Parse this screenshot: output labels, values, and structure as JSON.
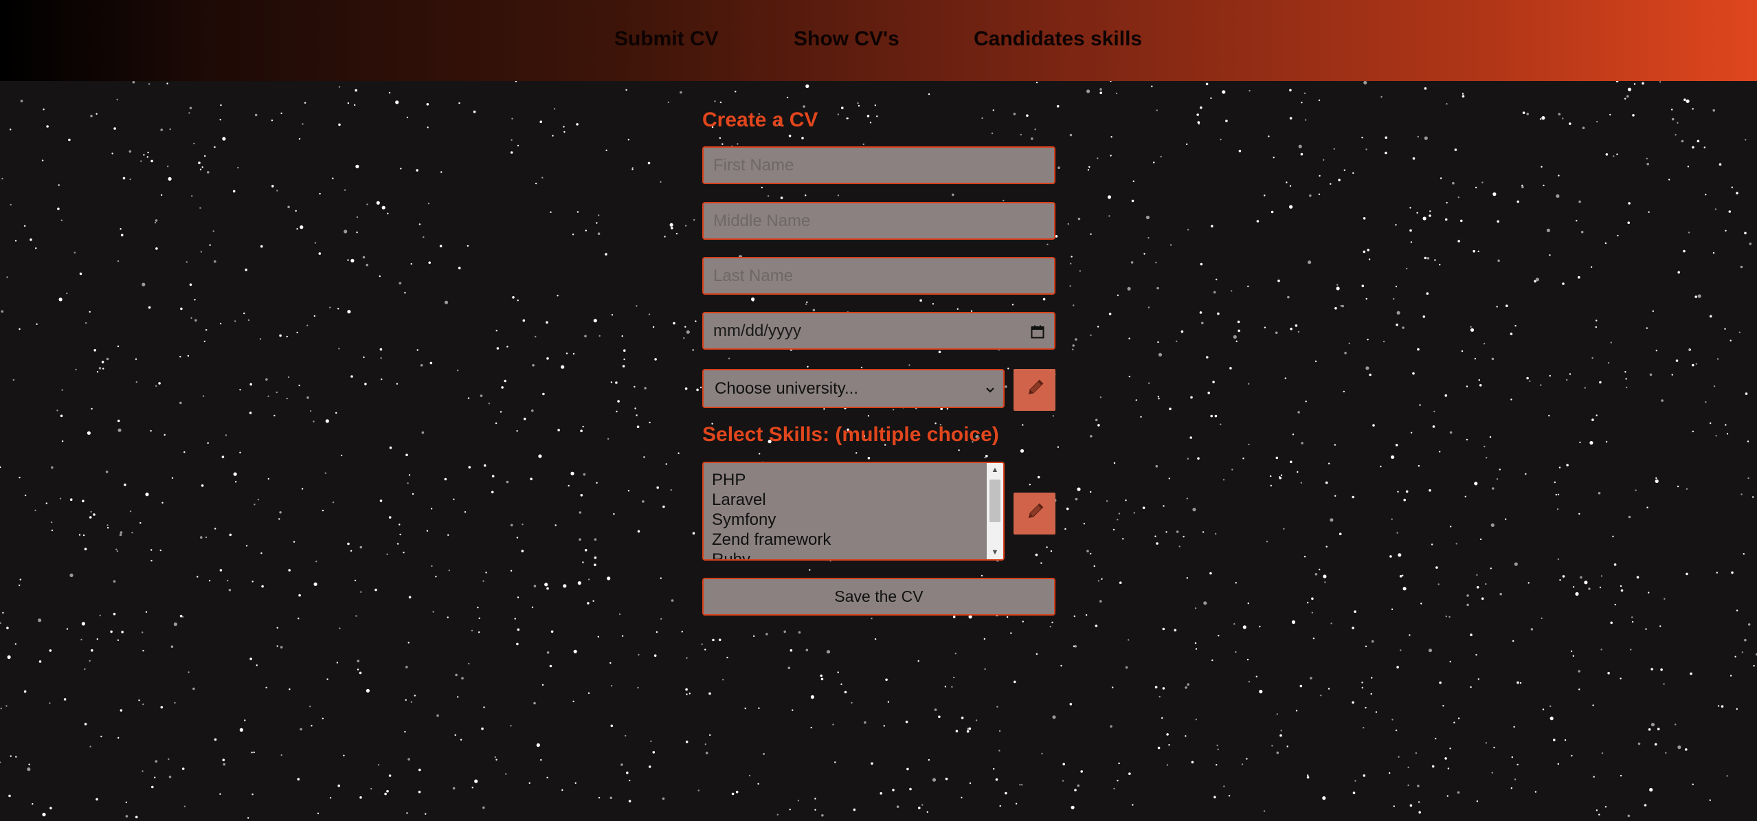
{
  "nav": {
    "items": [
      {
        "label": "Submit CV"
      },
      {
        "label": "Show CV's"
      },
      {
        "label": "Candidates skills"
      }
    ]
  },
  "form": {
    "title": "Create a CV",
    "first_name": {
      "placeholder": "First Name",
      "value": ""
    },
    "middle_name": {
      "placeholder": "Middle Name",
      "value": ""
    },
    "last_name": {
      "placeholder": "Last Name",
      "value": ""
    },
    "birth_date": {
      "placeholder": "mm/dd/yyyy",
      "icon": "calendar-icon"
    },
    "university": {
      "selected": "Choose university...",
      "icon": "chevron-down-icon"
    },
    "university_edit": {
      "icon": "pencil-icon"
    },
    "skills_title": "Select Skills: (multiple choice)",
    "skills": [
      "PHP",
      "Laravel",
      "Symfony",
      "Zend framework",
      "Ruby"
    ],
    "skills_edit": {
      "icon": "pencil-icon"
    },
    "save_label": "Save the CV"
  },
  "colors": {
    "accent": "#e2461d",
    "field_bg": "#8b8181",
    "field_border": "#d8401a",
    "edit_button_bg": "#d0634a",
    "page_bg": "#151314",
    "nav_gradient_start": "#000000",
    "nav_gradient_end": "#df461e"
  }
}
